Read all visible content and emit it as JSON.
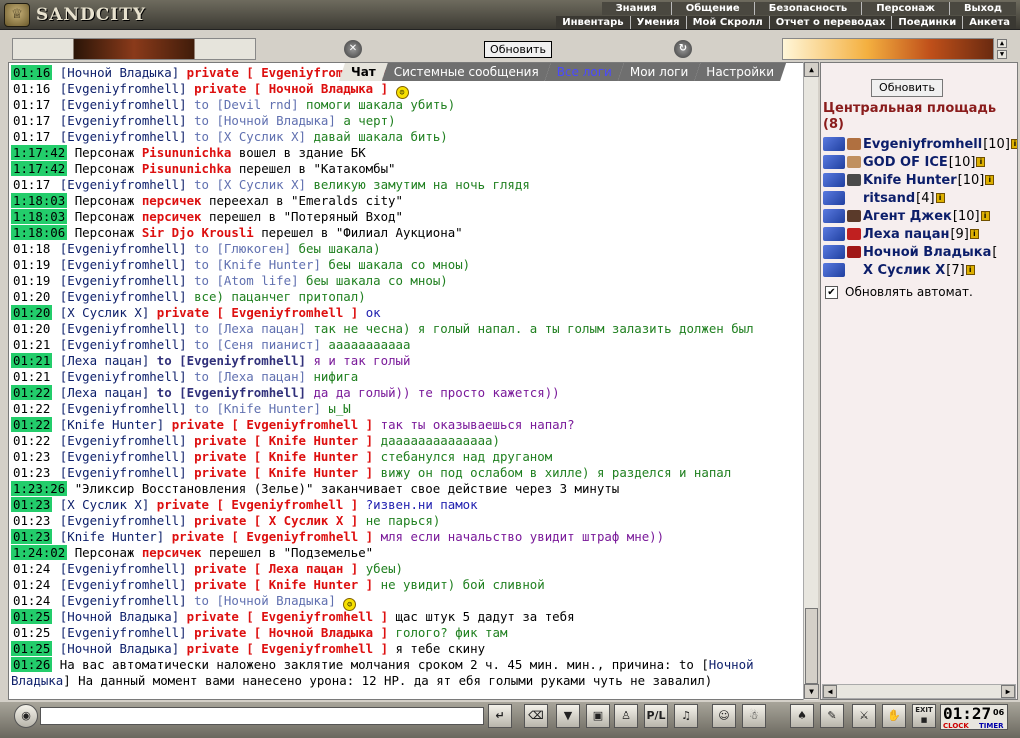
{
  "app": {
    "name": "SANDCITY"
  },
  "menu": {
    "row1": [
      "Знания",
      "Общение",
      "Безопасность",
      "Персонаж",
      "Выход"
    ],
    "row2": [
      "Инвентарь",
      "Умения",
      "Мой Скролл",
      "Отчет о переводах",
      "Поединки",
      "Анкета"
    ]
  },
  "header": {
    "update_label": "Обновить"
  },
  "tabs": [
    {
      "label": "Чат",
      "active": true
    },
    {
      "label": "Системные сообщения"
    },
    {
      "label": "Все логи",
      "link": true
    },
    {
      "label": "Мои логи"
    },
    {
      "label": "Настройки"
    }
  ],
  "chat": {
    "first_line": {
      "ts": "01:16",
      "nick": "Ночной Владыка",
      "private_to": "private [ Evgeniyfromhell ]"
    },
    "lines": [
      {
        "ts": "01:16",
        "nick": "Evgeniyfromhell",
        "priv": "private [ Ночной Владыка ]",
        "msg": "",
        "smile": true
      },
      {
        "ts": "01:17",
        "nick": "Evgeniyfromhell",
        "to": "to [Devil rnd]",
        "msg": "помоги шакала убить)",
        "color": "green"
      },
      {
        "ts": "01:17",
        "nick": "Evgeniyfromhell",
        "to": "to [Ночной Владыка]",
        "msg": "а черт)",
        "color": "green"
      },
      {
        "ts": "01:17",
        "nick": "Evgeniyfromhell",
        "to": "to [Х Суслик Х]",
        "msg": "давай шакала бить)",
        "color": "green"
      },
      {
        "ts": "1:17:42",
        "hl": true,
        "pre": "Персонаж",
        "sys": "Pisununichka",
        "msg": "вошел в здание БК"
      },
      {
        "ts": "1:17:42",
        "hl": true,
        "pre": "Персонаж",
        "sys": "Pisununichka",
        "msg": "перешел в \"Катакомбы\""
      },
      {
        "ts": "01:17",
        "nick": "Evgeniyfromhell",
        "to": "to [Х Суслик Х]",
        "msg": "великую замутим на ночь глядя",
        "color": "green"
      },
      {
        "ts": "1:18:03",
        "hl": true,
        "pre": "Персонаж",
        "sys": "персичек",
        "msg": "переехал в \"Emeralds city\""
      },
      {
        "ts": "1:18:03",
        "hl": true,
        "pre": "Персонаж",
        "sys": "персичек",
        "msg": "перешел в \"Потеряный Вход\""
      },
      {
        "ts": "1:18:06",
        "hl": true,
        "pre": "Персонаж",
        "sys": "Sir Djo Krousli",
        "msg": "перешел в \"Филиал Аукциона\""
      },
      {
        "ts": "01:18",
        "nick": "Evgeniyfromhell",
        "to": "to [Глюкоген]",
        "msg": "беы шакала)",
        "color": "green"
      },
      {
        "ts": "01:19",
        "nick": "Evgeniyfromhell",
        "to": "to [Knife Hunter]",
        "msg": "беы шакала со мноы)",
        "color": "green"
      },
      {
        "ts": "01:19",
        "nick": "Evgeniyfromhell",
        "to": "to [Atom life]",
        "msg": "беы шакала со мноы)",
        "color": "green"
      },
      {
        "ts": "01:20",
        "nick": "Evgeniyfromhell",
        "msg": "все) пацанчег притопал)",
        "color": "green"
      },
      {
        "ts": "01:20",
        "hl": true,
        "nick": "Х Суслик Х",
        "priv": "private [ Evgeniyfromhell ]",
        "msg": "ок",
        "color": "blue"
      },
      {
        "ts": "01:20",
        "nick": "Evgeniyfromhell",
        "to": "to [Леха пацан]",
        "msg": "так не чесна) я голый напал. а ты голым залазить должен был",
        "color": "green"
      },
      {
        "ts": "01:21",
        "nick": "Evgeniyfromhell",
        "to": "to [Сеня пианист]",
        "msg": "ааааааааааа",
        "color": "green"
      },
      {
        "ts": "01:21",
        "hl": true,
        "nick": "Леха пацан",
        "to": "to [Evgeniyfromhell]",
        "strong": true,
        "msg": "я и так голый",
        "color": "purple"
      },
      {
        "ts": "01:21",
        "nick": "Evgeniyfromhell",
        "to": "to [Леха пацан]",
        "msg": "нифига",
        "color": "green"
      },
      {
        "ts": "01:22",
        "hl": true,
        "nick": "Леха пацан",
        "to": "to [Evgeniyfromhell]",
        "strong": true,
        "msg": "да да голый)) те просто кажется))",
        "color": "purple"
      },
      {
        "ts": "01:22",
        "nick": "Evgeniyfromhell",
        "to": "to [Knife Hunter]",
        "msg": "ы_Ы",
        "color": "green"
      },
      {
        "ts": "01:22",
        "hl": true,
        "nick": "Knife Hunter",
        "priv": "private [ Evgeniyfromhell ]",
        "msg": "так ты оказываешься напал?",
        "color": "purple"
      },
      {
        "ts": "01:22",
        "nick": "Evgeniyfromhell",
        "priv": "private [ Knife Hunter ]",
        "msg": "даааааааааааааа)",
        "color": "green"
      },
      {
        "ts": "01:23",
        "nick": "Evgeniyfromhell",
        "priv": "private [ Knife Hunter ]",
        "msg": "стебанулся над друганом",
        "color": "green"
      },
      {
        "ts": "01:23",
        "nick": "Evgeniyfromhell",
        "priv": "private [ Knife Hunter ]",
        "msg": "вижу он под ослабом в хилле) я разделся и напал",
        "color": "green"
      },
      {
        "ts": "1:23:26",
        "hl": true,
        "msg": "\"Эликсир Восстановления (Зелье)\" заканчивает свое действие через 3 минуты"
      },
      {
        "ts": "01:23",
        "hl": true,
        "nick": "Х Суслик Х",
        "priv": "private [ Evgeniyfromhell ]",
        "msg": "?извен.ни памок",
        "color": "blue"
      },
      {
        "ts": "01:23",
        "nick": "Evgeniyfromhell",
        "priv": "private [ Х Суслик Х ]",
        "msg": "не парься)",
        "color": "green"
      },
      {
        "ts": "01:23",
        "hl": true,
        "nick": "Knife Hunter",
        "priv": "private [ Evgeniyfromhell ]",
        "msg": "мля если начальство увидит штраф мне))",
        "color": "purple"
      },
      {
        "ts": "1:24:02",
        "hl": true,
        "pre": "Персонаж",
        "sys": "персичек",
        "msg": "перешел в \"Подземелье\""
      },
      {
        "ts": "01:24",
        "nick": "Evgeniyfromhell",
        "priv": "private [ Леха пацан ]",
        "msg": "убеы)",
        "color": "green"
      },
      {
        "ts": "01:24",
        "nick": "Evgeniyfromhell",
        "priv": "private [ Knife Hunter ]",
        "msg": "не увидит) бой сливной",
        "color": "green"
      },
      {
        "ts": "01:24",
        "nick": "Evgeniyfromhell",
        "to": "to [Ночной Владыка]",
        "msg": "",
        "smile": true
      },
      {
        "ts": "01:25",
        "hl": true,
        "nick": "Ночной Владыка",
        "priv": "private [ Evgeniyfromhell ]",
        "msg": "щас штук 5 дадут за тебя"
      },
      {
        "ts": "01:25",
        "nick": "Evgeniyfromhell",
        "priv": "private [ Ночной Владыка ]",
        "msg": "голого? фик там",
        "color": "green"
      },
      {
        "ts": "01:25",
        "hl": true,
        "nick": "Ночной Владыка",
        "priv": "private [ Evgeniyfromhell ]",
        "msg": "я тебе скину"
      }
    ],
    "last_line": {
      "ts": "01:26",
      "text1": "На вас автоматически наложено заклятие молчания сроком 2 ч. 45 мин. мин., причина: to [",
      "nick": "Ночной Владыка",
      "text2": "] На данный момент вами нанесено урона: 12 HP. да ят ебя голыми руками чуть не завалил)"
    }
  },
  "side": {
    "update_label": "Обновить",
    "room_title": "Центральная площадь (8)",
    "users": [
      {
        "name": "Evgeniyfromhell",
        "level": "[10]",
        "badge": "#b07040"
      },
      {
        "name": "GOD OF ICE",
        "level": "[10]",
        "badge": "#c09060"
      },
      {
        "name": "Knife Hunter",
        "level": "[10]",
        "badge": "#4a4a4a"
      },
      {
        "name": "ritsand",
        "level": "[4]",
        "badge": ""
      },
      {
        "name": "Агент Джек",
        "level": "[10]",
        "badge": "#5a3a2a"
      },
      {
        "name": "Леха пацан",
        "level": "[9]",
        "badge": "#c02020"
      },
      {
        "name": "Ночной Владыка",
        "level": "[",
        "badge": "#a01818"
      },
      {
        "name": "Х Суслик Х",
        "level": "[7]",
        "badge": ""
      }
    ],
    "auto_update_label": "Обновлять автомат."
  },
  "clock": {
    "time": "01:27",
    "seconds": "06",
    "clock_label": "CLOCK",
    "timer_label": "TIMER"
  },
  "colors": {
    "timestamp_highlight": "#23cd6b",
    "private": "#dd0f0f",
    "nick": "#0c1e6a"
  }
}
